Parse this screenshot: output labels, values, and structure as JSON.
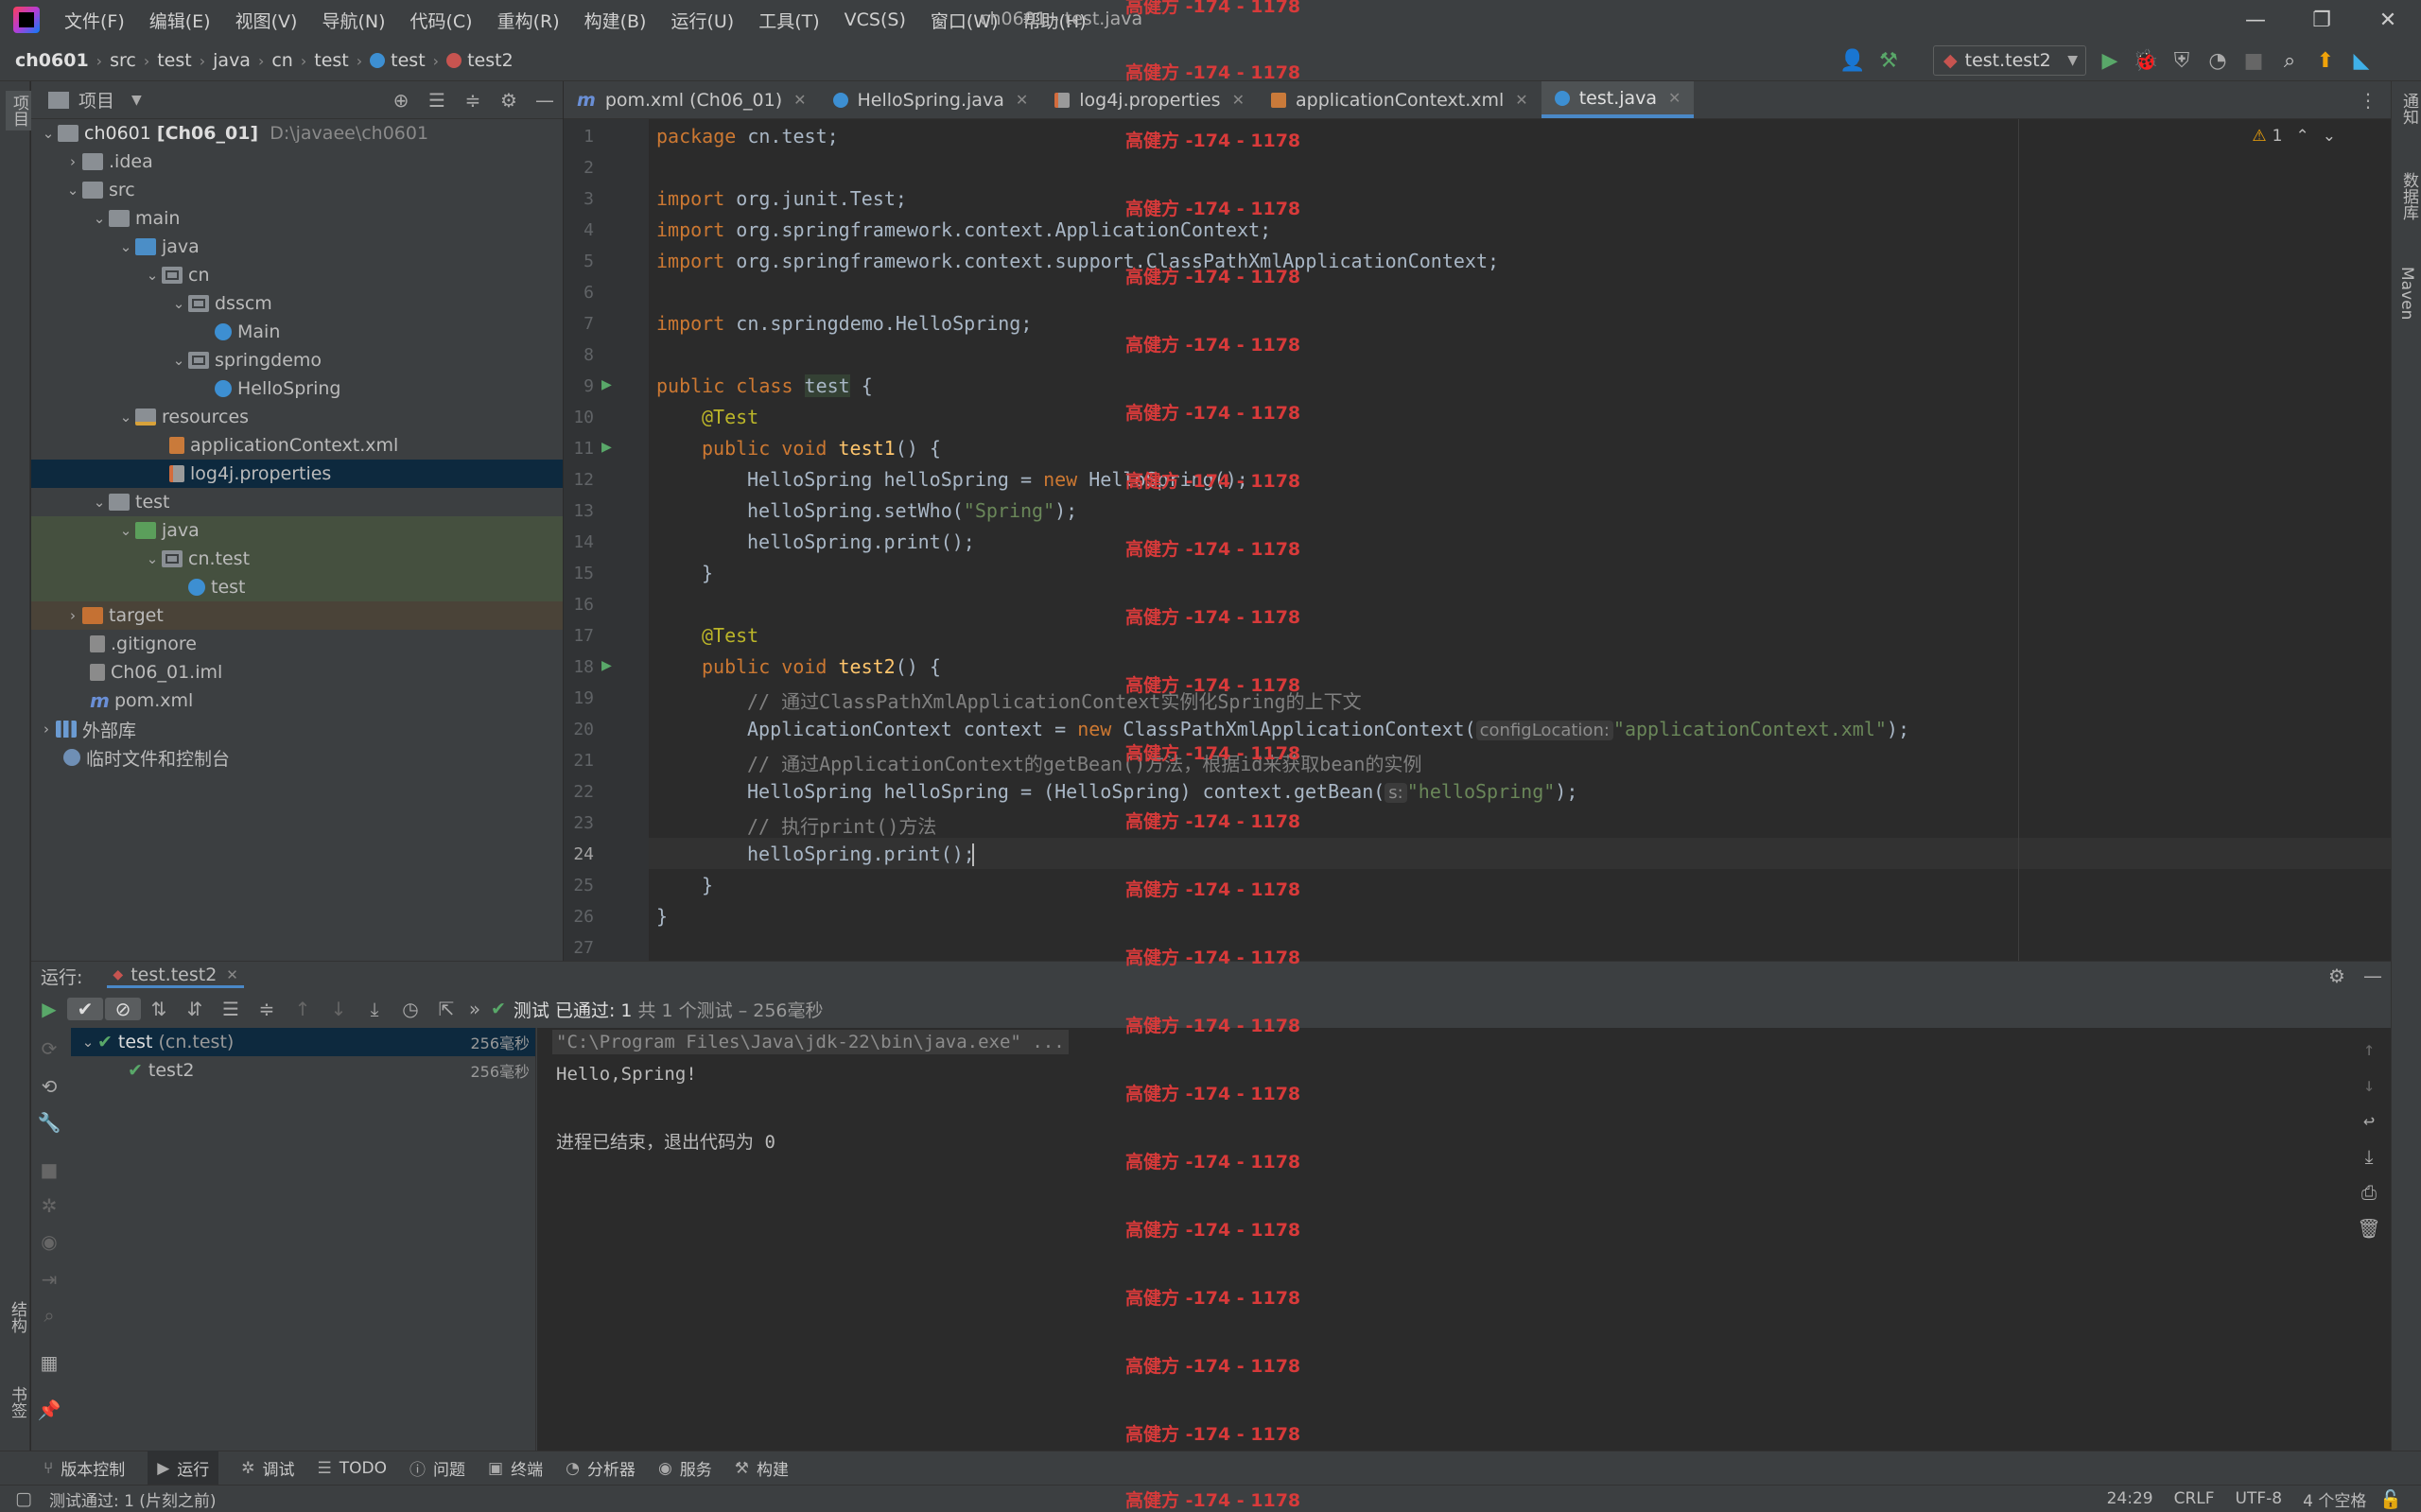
{
  "window": {
    "title": "ch0601 - test.java",
    "menu": [
      "文件(F)",
      "编辑(E)",
      "视图(V)",
      "导航(N)",
      "代码(C)",
      "重构(R)",
      "构建(B)",
      "运行(U)",
      "工具(T)",
      "VCS(S)",
      "窗口(W)",
      "帮助(H)"
    ]
  },
  "breadcrumb": [
    "ch0601",
    "src",
    "test",
    "java",
    "cn",
    "test",
    "test",
    "test2"
  ],
  "run_config": "test.test2",
  "left_strip": {
    "project": "项目",
    "structure": "结构",
    "bookmarks": "书签"
  },
  "right_strip": {
    "notifications": "通知",
    "database": "数据库",
    "maven": "Maven"
  },
  "project_panel": {
    "title": "项目",
    "root_name": "ch0601",
    "root_module": "[Ch06_01]",
    "root_path": "D:\\javaee\\ch0601",
    "items": [
      {
        "label": ".idea",
        "depth": 1
      },
      {
        "label": "src",
        "depth": 1
      },
      {
        "label": "main",
        "depth": 2
      },
      {
        "label": "java",
        "depth": 3
      },
      {
        "label": "cn",
        "depth": 4
      },
      {
        "label": "dsscm",
        "depth": 5
      },
      {
        "label": "Main",
        "depth": 6
      },
      {
        "label": "springdemo",
        "depth": 5
      },
      {
        "label": "HelloSpring",
        "depth": 6
      },
      {
        "label": "resources",
        "depth": 3
      },
      {
        "label": "applicationContext.xml",
        "depth": 4
      },
      {
        "label": "log4j.properties",
        "depth": 4
      },
      {
        "label": "test",
        "depth": 2
      },
      {
        "label": "java",
        "depth": 3
      },
      {
        "label": "cn.test",
        "depth": 4
      },
      {
        "label": "test",
        "depth": 5
      },
      {
        "label": "target",
        "depth": 1
      },
      {
        "label": ".gitignore",
        "depth": 1
      },
      {
        "label": "Ch06_01.iml",
        "depth": 1
      },
      {
        "label": "pom.xml",
        "depth": 1
      },
      {
        "label": "外部库",
        "depth": 0
      },
      {
        "label": "临时文件和控制台",
        "depth": 0
      }
    ]
  },
  "editor_tabs": [
    "pom.xml (Ch06_01)",
    "HelloSpring.java",
    "log4j.properties",
    "applicationContext.xml",
    "test.java"
  ],
  "editor": {
    "warning_count": "1",
    "line_numbers": [
      "1",
      "2",
      "3",
      "4",
      "5",
      "6",
      "7",
      "8",
      "9",
      "10",
      "11",
      "12",
      "13",
      "14",
      "15",
      "16",
      "17",
      "18",
      "19",
      "20",
      "21",
      "22",
      "23",
      "24",
      "25",
      "26",
      "27"
    ],
    "lines": {
      "l1_kw": "package",
      "l1_rest": " cn.test;",
      "l3_kw": "import",
      "l3_rest": " org.junit.Test;",
      "l4_kw": "import",
      "l4_rest": " org.springframework.context.ApplicationContext;",
      "l5_kw": "import",
      "l5_rest": " org.springframework.context.support.ClassPathXmlApplicationContext;",
      "l7_kw": "import",
      "l7_rest": " cn.springdemo.HelloSpring;",
      "l9_kw": "public class ",
      "l9_name": "test",
      "l9_rest": " {",
      "l10": "@Test",
      "l11_kw": "public void ",
      "l11_fn": "test1",
      "l11_rest": "() {",
      "l12_a": "HelloSpring helloSpring = ",
      "l12_kw": "new",
      "l12_b": " HelloSpring();",
      "l13_a": "helloSpring.setWho(",
      "l13_str": "\"Spring\"",
      "l13_b": ");",
      "l14": "helloSpring.print();",
      "l15": "}",
      "l17": "@Test",
      "l18_kw": "public void ",
      "l18_fn": "test2",
      "l18_rest": "() {",
      "l19": "// 通过ClassPathXmlApplicationContext实例化Spring的上下文",
      "l20_a": "ApplicationContext context = ",
      "l20_kw": "new",
      "l20_b": " ClassPathXmlApplicationContext(",
      "l20_hint": "configLocation:",
      "l20_str": "\"applicationContext.xml\"",
      "l20_c": ");",
      "l21": "// 通过ApplicationContext的getBean()方法，根据id来获取bean的实例",
      "l22_a": "HelloSpring helloSpring = (HelloSpring) context.getBean(",
      "l22_hint": "s:",
      "l22_str": "\"helloSpring\"",
      "l22_b": ");",
      "l23": "// 执行print()方法",
      "l24": "helloSpring.print();",
      "l25": "}",
      "l26": "}"
    }
  },
  "run_panel": {
    "label": "运行:",
    "tab": "test.test2",
    "status_text": "测试 已通过: 1",
    "status_detail": "共 1 个测试 – 256毫秒",
    "tests": [
      {
        "name": "test",
        "pkg": "(cn.test)",
        "time": "256毫秒"
      },
      {
        "name": "test2",
        "time": "256毫秒"
      }
    ],
    "console": [
      "\"C:\\Program Files\\Java\\jdk-22\\bin\\java.exe\" ...",
      "Hello,Spring!",
      "",
      "进程已结束，退出代码为 0"
    ]
  },
  "bottom_tabs": [
    "版本控制",
    "运行",
    "调试",
    "TODO",
    "问题",
    "终端",
    "分析器",
    "服务",
    "构建"
  ],
  "status_bar": {
    "message": "测试通过: 1 (片刻之前)",
    "position": "24:29",
    "line_sep": "CRLF",
    "encoding": "UTF-8",
    "indent": "4 个空格"
  },
  "watermark": "高健方 -174 - 1178",
  "colors": {
    "accent": "#4a88c7",
    "success": "#59a869",
    "watermark": "#d83a3a"
  }
}
